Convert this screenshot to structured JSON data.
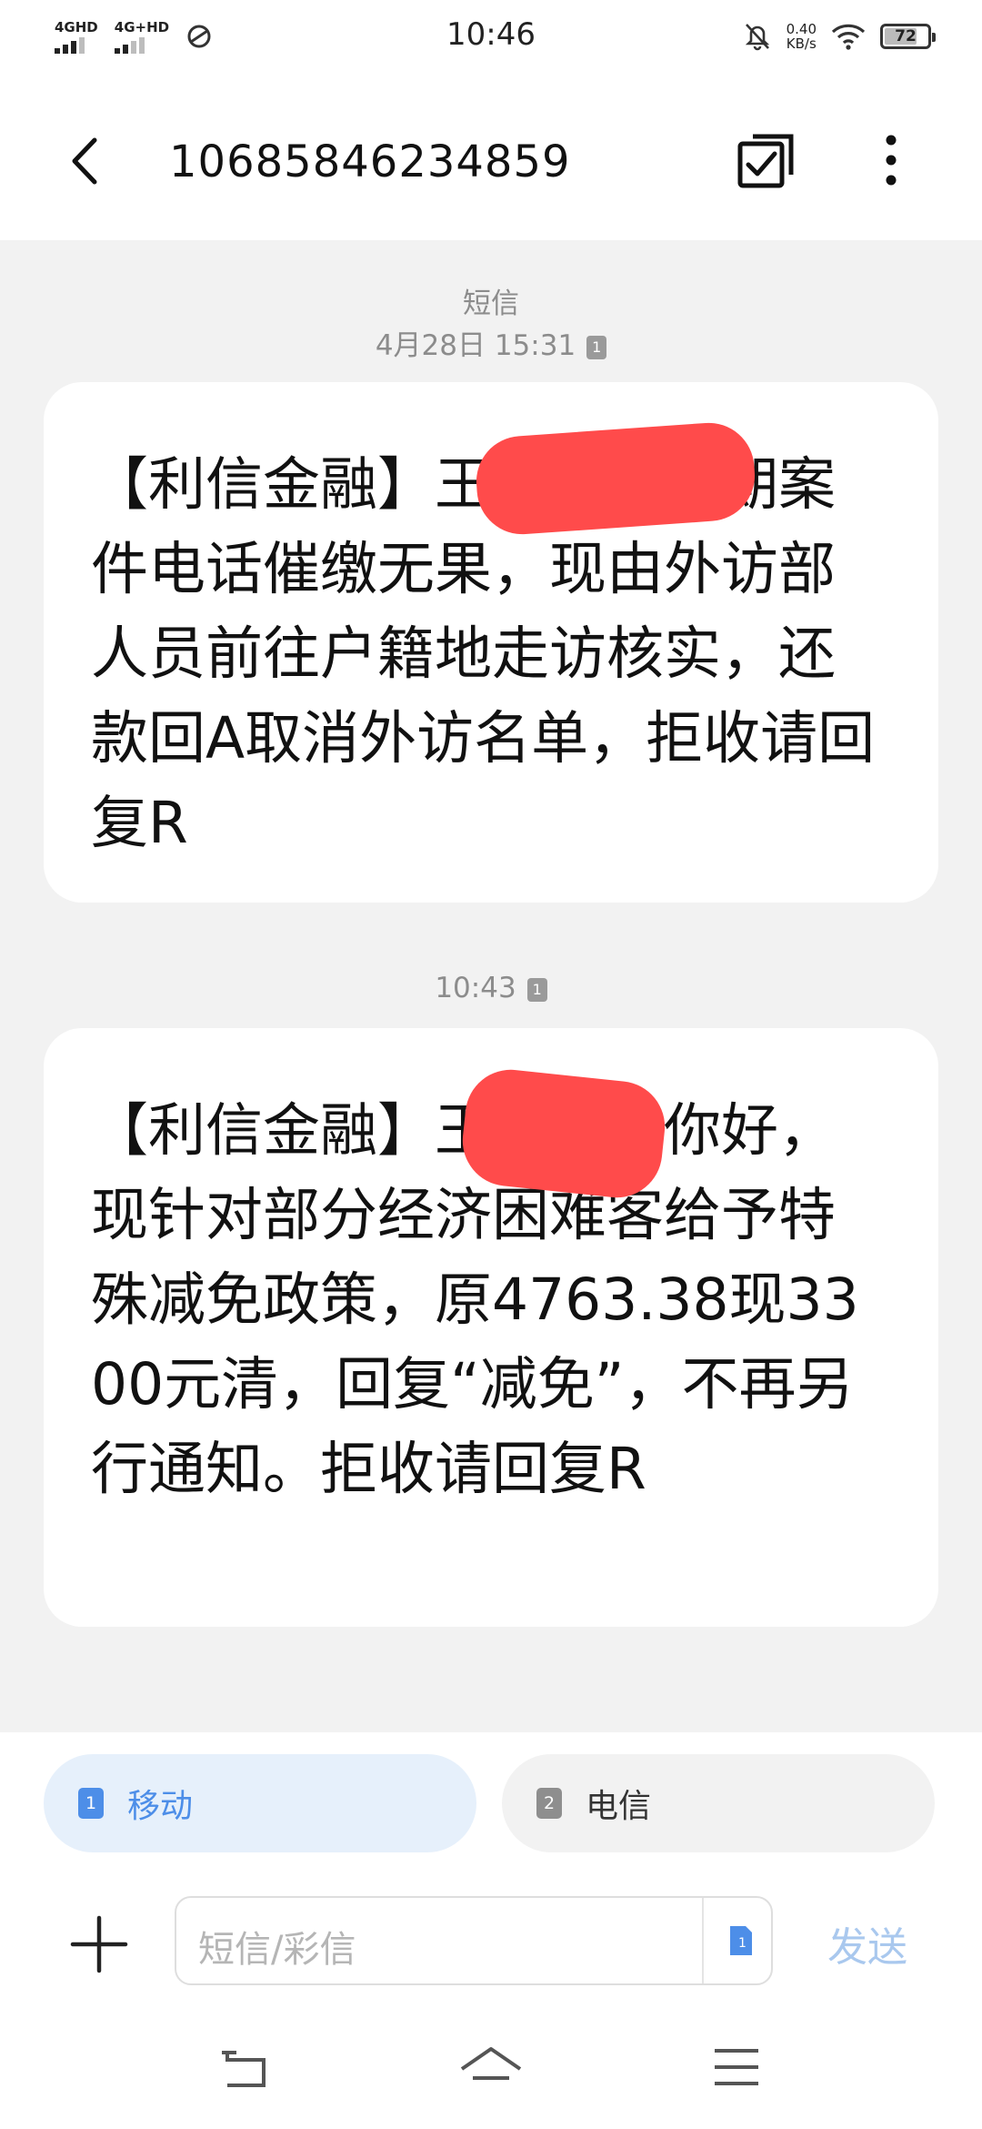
{
  "status_bar": {
    "time": "10:46",
    "signal1_label": "4GHD",
    "signal2_label": "4G+HD",
    "speed_value": "0.40",
    "speed_unit": "KB/s",
    "battery_level": "72",
    "icons": [
      "hotspot-icon",
      "mute-icon",
      "wifi-icon",
      "battery-icon"
    ]
  },
  "header": {
    "contact_number": "10685846234859",
    "back_icon": "back-arrow-icon",
    "select_icon": "multi-select-icon",
    "more_icon": "more-vertical-icon"
  },
  "conversation": {
    "first_group": {
      "type_label": "短信",
      "timestamp": "4月28日 15:31",
      "sim_badge": "1"
    },
    "messages": [
      {
        "text": "【利信金融】王先生，逾期案件电话催缴无果，现由外访部人员前往户籍地走访核实，还款回A取消外访名单，拒收请回复R"
      },
      {
        "timestamp": "10:43",
        "sim_badge": "1",
        "text": "【利信金融】王先生您你好，现针对部分经济困难客给予特殊减免政策，原4763.38现3300元清，回复“减免”，不再另行通知。拒收请回复R"
      }
    ]
  },
  "sim_selector": {
    "sim1": {
      "number": "1",
      "label": "移动"
    },
    "sim2": {
      "number": "2",
      "label": "电信"
    },
    "accent": "#4d8ee8"
  },
  "composer": {
    "placeholder": "短信/彩信",
    "send_label": "发送",
    "sim_badge": "1"
  },
  "nav_bar": {
    "icons": [
      "back-nav-icon",
      "home-nav-icon",
      "recents-menu-icon"
    ]
  }
}
